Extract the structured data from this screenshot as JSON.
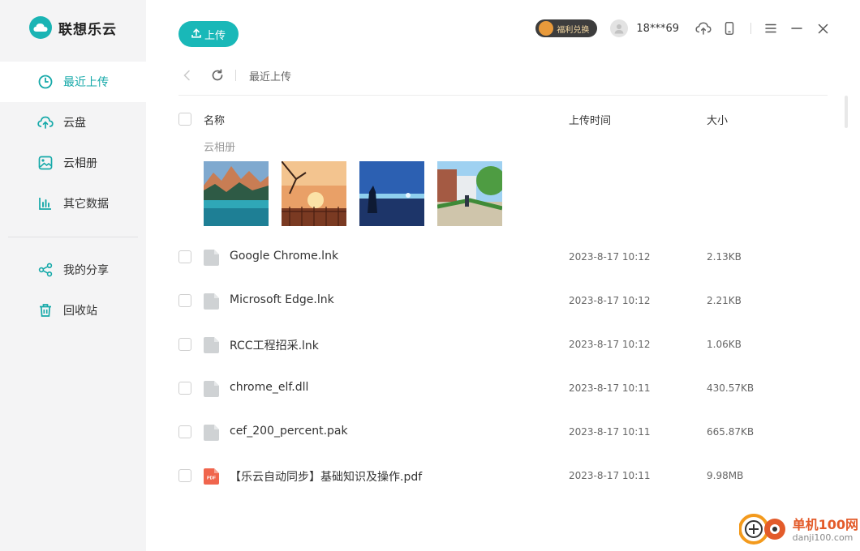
{
  "app": {
    "name": "联想乐云",
    "accent": "#19b8b8"
  },
  "sidebar": {
    "items": [
      {
        "label": "最近上传",
        "icon": "clock-icon",
        "active": true
      },
      {
        "label": "云盘",
        "icon": "cloud-upload-icon"
      },
      {
        "label": "云相册",
        "icon": "photo-icon"
      },
      {
        "label": "其它数据",
        "icon": "bar-chart-icon"
      }
    ],
    "items2": [
      {
        "label": "我的分享",
        "icon": "share-icon"
      },
      {
        "label": "回收站",
        "icon": "trash-icon"
      }
    ]
  },
  "toolbar": {
    "upload_label": "上传",
    "gift_label": "福利兑换",
    "username": "18***69"
  },
  "breadcrumb": {
    "current": "最近上传"
  },
  "table": {
    "headers": {
      "name": "名称",
      "time": "上传时间",
      "size": "大小"
    },
    "album_label": "云相册",
    "files": [
      {
        "name": "Google Chrome.lnk",
        "time": "2023-8-17 10:12",
        "size": "2.13KB",
        "type": "file"
      },
      {
        "name": "Microsoft Edge.lnk",
        "time": "2023-8-17 10:12",
        "size": "2.21KB",
        "type": "file"
      },
      {
        "name": "RCC工程招采.lnk",
        "time": "2023-8-17 10:12",
        "size": "1.06KB",
        "type": "file"
      },
      {
        "name": "chrome_elf.dll",
        "time": "2023-8-17 10:11",
        "size": "430.57KB",
        "type": "file"
      },
      {
        "name": "cef_200_percent.pak",
        "time": "2023-8-17 10:11",
        "size": "665.87KB",
        "type": "file"
      },
      {
        "name": "【乐云自动同步】基础知识及操作.pdf",
        "time": "2023-8-17 10:11",
        "size": "9.98MB",
        "type": "pdf"
      }
    ],
    "pdf_badge": "PDF"
  },
  "watermark": {
    "title": "单机100网",
    "url": "danji100.com"
  }
}
